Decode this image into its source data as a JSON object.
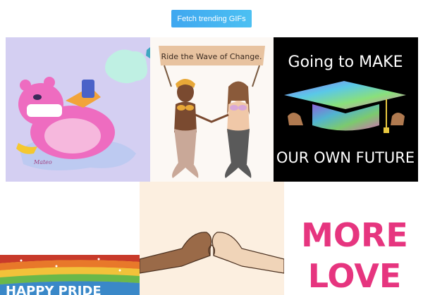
{
  "toolbar": {
    "fetch_label": "Fetch trending GIFs"
  },
  "gifs": [
    {
      "id": "gif-panda-mask",
      "caption": ""
    },
    {
      "id": "gif-mermaids",
      "caption": "Ride the Wave of Change."
    },
    {
      "id": "gif-graduation",
      "caption_top": "Going to MAKE",
      "caption_bottom": "OUR OWN FUTURE"
    },
    {
      "id": "gif-happy-pride",
      "caption": "HAPPY PRIDE"
    },
    {
      "id": "gif-heart-hands",
      "caption": ""
    },
    {
      "id": "gif-more-love",
      "caption_top": "MORE",
      "caption_bottom": "LOVE"
    }
  ],
  "colors": {
    "button_start": "#3fa7f0",
    "button_end": "#4cc0f2",
    "love_pink": "#e6357f"
  }
}
